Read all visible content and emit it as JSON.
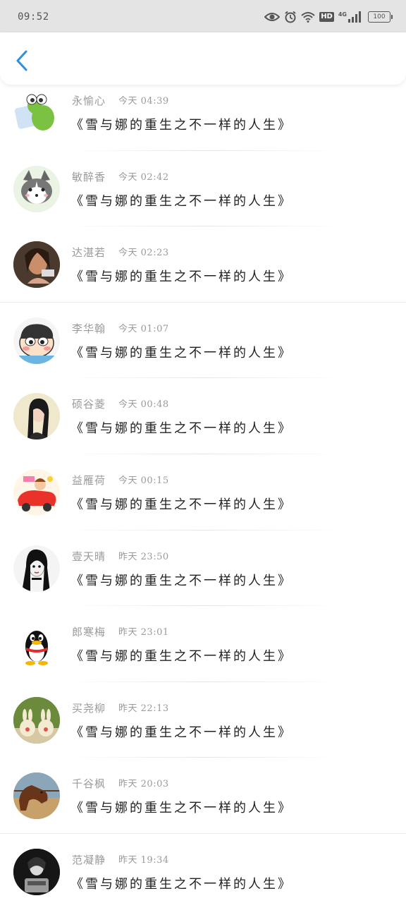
{
  "status_bar": {
    "time": "09:52",
    "network": "4G",
    "hd": "HD",
    "battery": "100"
  },
  "nav": {
    "back_icon": "chevron-left-icon",
    "accent": "#2f8fd8"
  },
  "items": [
    {
      "name": "永愉心",
      "time": "今天 04:39",
      "title": "《雪与娜的重生之不一样的人生》",
      "avatar": "green-frog-cartoon"
    },
    {
      "name": "敏醉香",
      "time": "今天 02:42",
      "title": "《雪与娜的重生之不一样的人生》",
      "avatar": "cartoon-husky-dog"
    },
    {
      "name": "达湛若",
      "time": "今天 02:23",
      "title": "《雪与娜的重生之不一样的人生》",
      "avatar": "woman-photo"
    },
    {
      "name": "李华翰",
      "time": "今天 01:07",
      "title": "《雪与娜的重生之不一样的人生》",
      "avatar": "crayon-boy-cartoon"
    },
    {
      "name": "硕谷菱",
      "time": "今天 00:48",
      "title": "《雪与娜的重生之不一样的人生》",
      "avatar": "girl-photo"
    },
    {
      "name": "益雁荷",
      "time": "今天 00:15",
      "title": "《雪与娜的重生之不一样的人生》",
      "avatar": "red-car-cartoon"
    },
    {
      "name": "壹天晴",
      "time": "昨天 23:50",
      "title": "《雪与娜的重生之不一样的人生》",
      "avatar": "dark-hair-girl-drawing"
    },
    {
      "name": "郎寒梅",
      "time": "昨天 23:01",
      "title": "《雪与娜的重生之不一样的人生》",
      "avatar": "qq-penguin"
    },
    {
      "name": "买尧柳",
      "time": "昨天 22:13",
      "title": "《雪与娜的重生之不一样的人生》",
      "avatar": "rabbit-toys"
    },
    {
      "name": "千谷枫",
      "time": "昨天 20:03",
      "title": "《雪与娜的重生之不一样的人生》",
      "avatar": "horse-photo"
    },
    {
      "name": "范凝静",
      "time": "昨天 19:34",
      "title": "《雪与娜的重生之不一样的人生》",
      "avatar": "dark-figure-photo"
    }
  ]
}
